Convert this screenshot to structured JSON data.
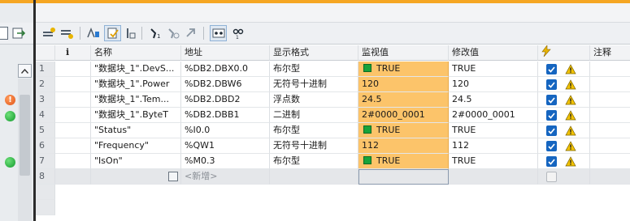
{
  "table": {
    "headers": {
      "index": "",
      "info": "i",
      "name": "名称",
      "address": "地址",
      "display_format": "显示格式",
      "monitor_value": "监视值",
      "modify_value": "修改值",
      "comment": "注释"
    },
    "rows": [
      {
        "num": "1",
        "name": "\"数据块_1\".DevS...",
        "address": "%DB2.DBX0.0",
        "format": "布尔型",
        "monitor": "TRUE",
        "modify": "TRUE",
        "status": ""
      },
      {
        "num": "2",
        "name": "\"数据块_1\".Power",
        "address": "%DB2.DBW6",
        "format": "无符号十进制",
        "monitor": "120",
        "modify": "120",
        "status": ""
      },
      {
        "num": "3",
        "name": "\"数据块_1\".Tem...",
        "address": "%DB2.DBD2",
        "format": "浮点数",
        "monitor": "24.5",
        "modify": "24.5",
        "status": "!"
      },
      {
        "num": "4",
        "name": "\"数据块_1\".ByteT",
        "address": "%DB2.DBB1",
        "format": "二进制",
        "monitor": "2#0000_0001",
        "modify": "2#0000_0001",
        "status": ""
      },
      {
        "num": "5",
        "name": "\"Status\"",
        "address": "%I0.0",
        "format": "布尔型",
        "monitor": "TRUE",
        "modify": "TRUE",
        "status": ""
      },
      {
        "num": "6",
        "name": "\"Frequency\"",
        "address": "%QW1",
        "format": "无符号十进制",
        "monitor": "112",
        "modify": "112",
        "status": ""
      },
      {
        "num": "7",
        "name": "\"IsOn\"",
        "address": "%M0.3",
        "format": "布尔型",
        "monitor": "TRUE",
        "modify": "TRUE",
        "status": ""
      },
      {
        "num": "8",
        "add_new": "<新增>"
      }
    ]
  },
  "icons": {
    "toolbar": [
      "table-grid-icon",
      "insert-row-icon",
      "add-row-icon",
      "delete-row-icon",
      "sort-icon",
      "modify-icon",
      "show-hide-icon",
      "modify-now-icon",
      "modify-all-icon",
      "force-icon",
      "monitor-all-icon",
      "monitor-once-icon"
    ]
  },
  "colors": {
    "accent": "#f5a623",
    "monitor_cell": "#fcc46a",
    "true_indicator": "#18a33a",
    "checkbox": "#1565c0",
    "warning": "#f2c200"
  }
}
